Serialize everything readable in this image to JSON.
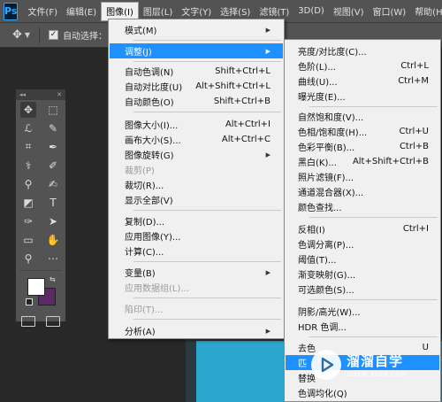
{
  "menubar": {
    "logo": "Ps",
    "items": [
      "文件(F)",
      "编辑(E)",
      "图像(I)",
      "图层(L)",
      "文字(Y)",
      "选择(S)",
      "滤镜(T)",
      "3D(D)",
      "视图(V)",
      "窗口(W)",
      "帮助(H)"
    ],
    "active_index": 2
  },
  "options_bar": {
    "auto_select_label": "自动选择：",
    "auto_select_checked": true
  },
  "image_menu": {
    "mode": {
      "label": "模式(M)"
    },
    "adjust": {
      "label": "调整(J)"
    },
    "auto_tone": {
      "label": "自动色调(N)",
      "shortcut": "Shift+Ctrl+L"
    },
    "auto_contrast": {
      "label": "自动对比度(U)",
      "shortcut": "Alt+Shift+Ctrl+L"
    },
    "auto_color": {
      "label": "自动颜色(O)",
      "shortcut": "Shift+Ctrl+B"
    },
    "image_size": {
      "label": "图像大小(I)...",
      "shortcut": "Alt+Ctrl+I"
    },
    "canvas_size": {
      "label": "画布大小(S)...",
      "shortcut": "Alt+Ctrl+C"
    },
    "image_rotation": {
      "label": "图像旋转(G)"
    },
    "crop": {
      "label": "裁剪(P)"
    },
    "trim": {
      "label": "裁切(R)..."
    },
    "reveal_all": {
      "label": "显示全部(V)"
    },
    "duplicate": {
      "label": "复制(D)..."
    },
    "apply_image": {
      "label": "应用图像(Y)..."
    },
    "calculations": {
      "label": "计算(C)..."
    },
    "variables": {
      "label": "变量(B)"
    },
    "apply_data_set": {
      "label": "应用数据组(L)..."
    },
    "trap": {
      "label": "陷印(T)..."
    },
    "analysis": {
      "label": "分析(A)"
    }
  },
  "adjust_menu": {
    "brightness_contrast": {
      "label": "亮度/对比度(C)..."
    },
    "levels": {
      "label": "色阶(L)...",
      "shortcut": "Ctrl+L"
    },
    "curves": {
      "label": "曲线(U)...",
      "shortcut": "Ctrl+M"
    },
    "exposure": {
      "label": "曝光度(E)..."
    },
    "vibrance": {
      "label": "自然饱和度(V)..."
    },
    "hue_saturation": {
      "label": "色相/饱和度(H)...",
      "shortcut": "Ctrl+U"
    },
    "color_balance": {
      "label": "色彩平衡(B)...",
      "shortcut": "Ctrl+B"
    },
    "black_white": {
      "label": "黑白(K)...",
      "shortcut": "Alt+Shift+Ctrl+B"
    },
    "photo_filter": {
      "label": "照片滤镜(F)..."
    },
    "channel_mixer": {
      "label": "通道混合器(X)..."
    },
    "color_lookup": {
      "label": "颜色查找..."
    },
    "invert": {
      "label": "反相(I)",
      "shortcut": "Ctrl+I"
    },
    "posterize": {
      "label": "色调分离(P)..."
    },
    "threshold": {
      "label": "阈值(T)..."
    },
    "gradient_map": {
      "label": "渐变映射(G)..."
    },
    "selective_color": {
      "label": "可选颜色(S)..."
    },
    "shadows_highlights": {
      "label": "阴影/高光(W)..."
    },
    "hdr_toning": {
      "label": "HDR 色调..."
    },
    "desaturate": {
      "label": "去色",
      "shortcut": "U"
    },
    "match_color": {
      "label": "匹"
    },
    "replace_color": {
      "label": "替换"
    },
    "equalize": {
      "label": "色调均化(Q)"
    }
  },
  "watermark": {
    "title": "溜溜自学",
    "url": "ZIXUE.3D66.COM"
  },
  "colors": {
    "menu_highlight": "#1e90ff",
    "foreground": "#ffffff",
    "background": "#5a2a64",
    "canvas": "#2aa6cf"
  }
}
